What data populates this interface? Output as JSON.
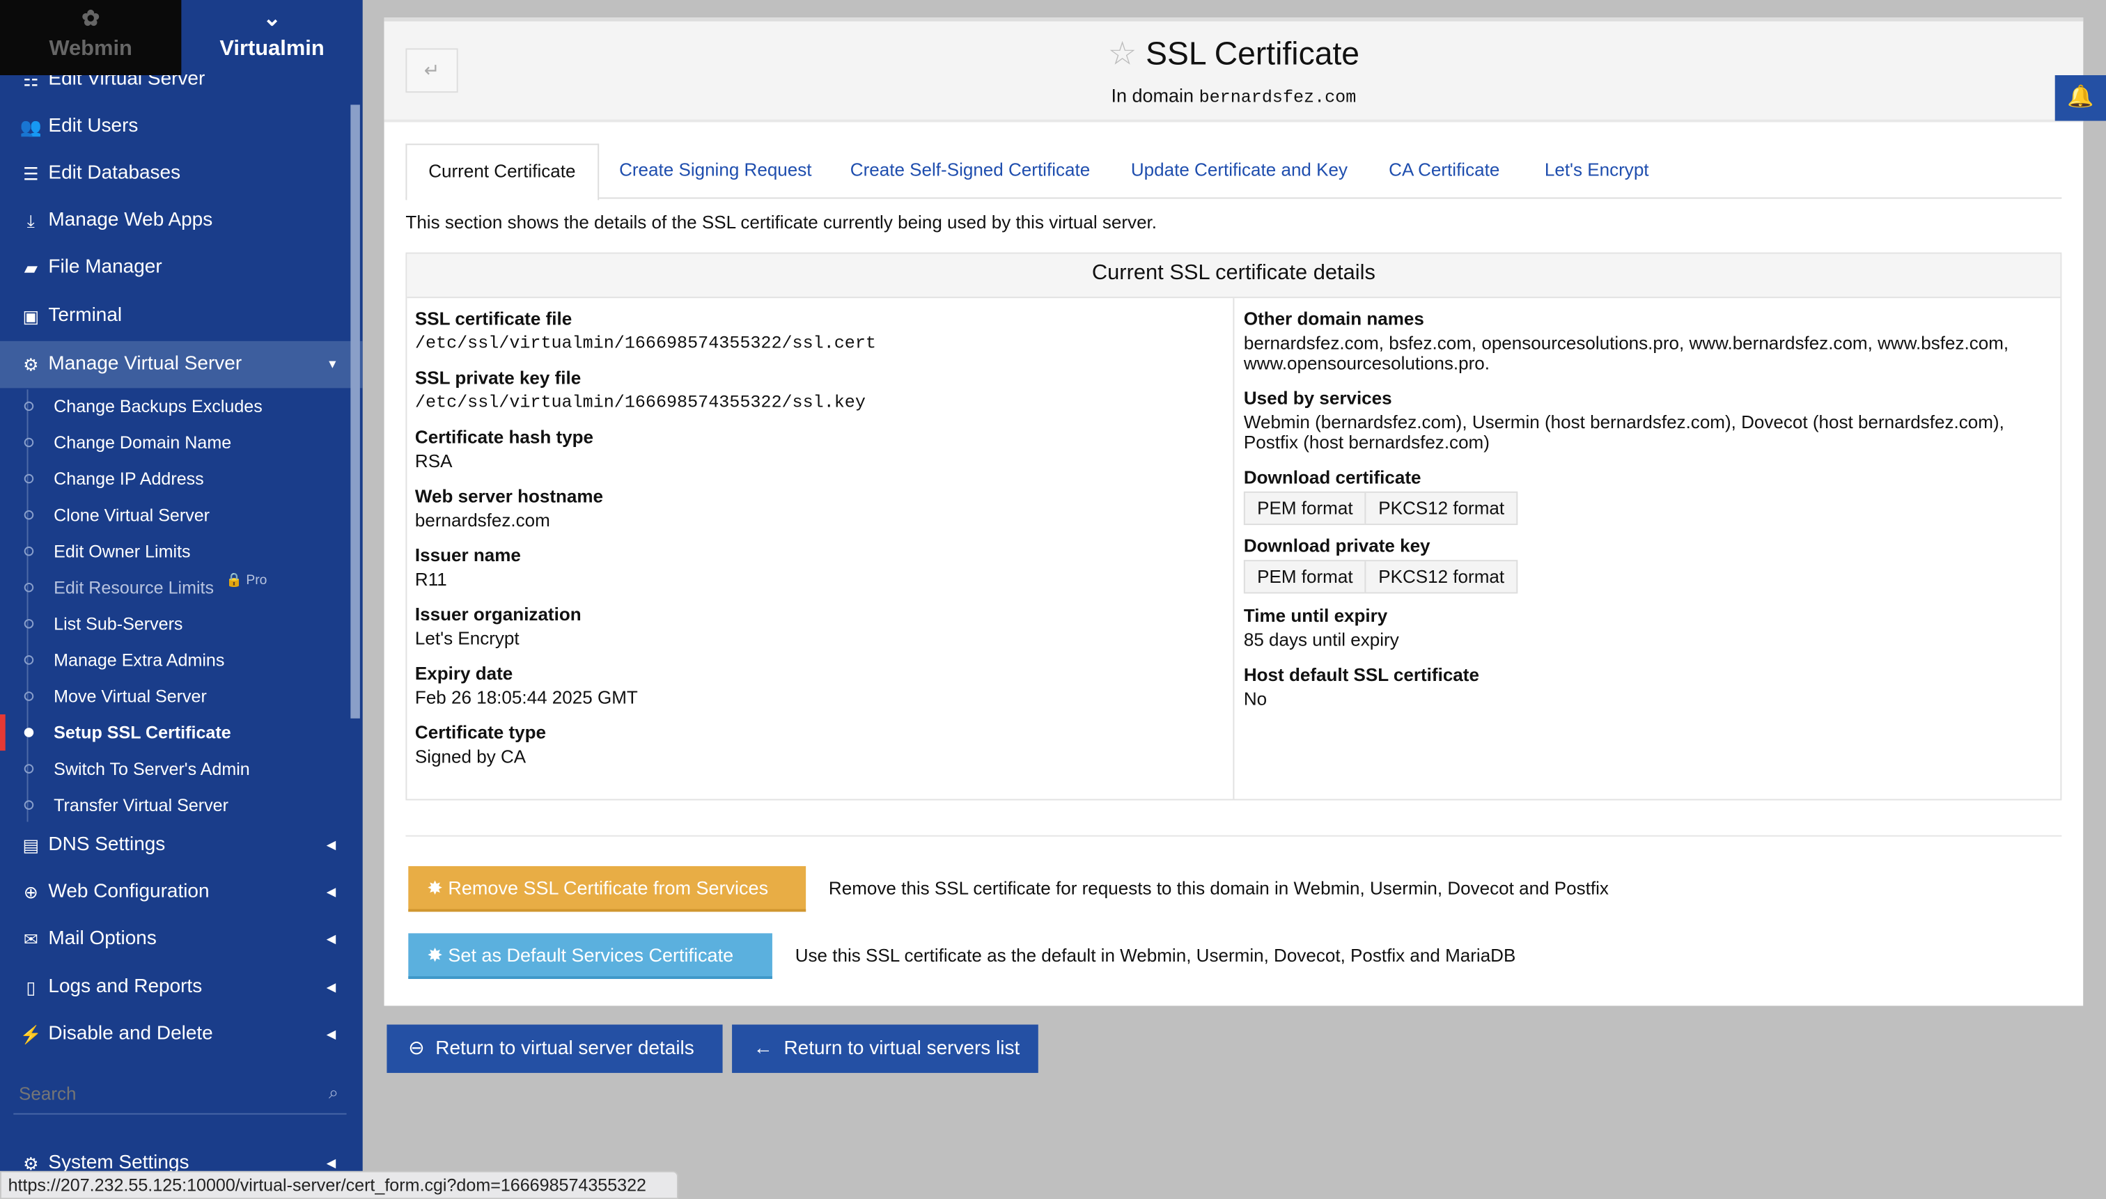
{
  "sidebar": {
    "tabs": [
      {
        "label": "Webmin",
        "icon": "webmin-logo-icon"
      },
      {
        "label": "Virtualmin",
        "icon": "virtualmin-chevron-icon"
      }
    ],
    "items": [
      {
        "label": "Edit Virtual Server",
        "icon": "sliders-icon"
      },
      {
        "label": "Edit Users",
        "icon": "users-cog-icon"
      },
      {
        "label": "Edit Databases",
        "icon": "database-icon"
      },
      {
        "label": "Manage Web Apps",
        "icon": "download-box-icon"
      },
      {
        "label": "File Manager",
        "icon": "folder-icon"
      },
      {
        "label": "Terminal",
        "icon": "terminal-icon"
      },
      {
        "label": "Manage Virtual Server",
        "icon": "cogs-icon"
      }
    ],
    "subitems": [
      "Change Backups Excludes",
      "Change Domain Name",
      "Change IP Address",
      "Clone Virtual Server",
      "Edit Owner Limits",
      "Edit Resource Limits",
      "List Sub-Servers",
      "Manage Extra Admins",
      "Move Virtual Server",
      "Setup SSL Certificate",
      "Switch To Server's Admin",
      "Transfer Virtual Server"
    ],
    "pro_badge": "Pro",
    "active_subitem": "Setup SSL Certificate",
    "groups": [
      {
        "label": "DNS Settings",
        "icon": "server-icon"
      },
      {
        "label": "Web Configuration",
        "icon": "globe-icon"
      },
      {
        "label": "Mail Options",
        "icon": "envelope-open-icon"
      },
      {
        "label": "Logs and Reports",
        "icon": "file-icon"
      },
      {
        "label": "Disable and Delete",
        "icon": "plug-icon"
      }
    ],
    "search_placeholder": "Search",
    "system_settings": "System Settings"
  },
  "header": {
    "title": "SSL Certificate",
    "subtitle_prefix": "In domain",
    "domain": "bernardsfez.com"
  },
  "tabs": [
    "Current Certificate",
    "Create Signing Request",
    "Create Self-Signed Certificate",
    "Update Certificate and Key",
    "CA Certificate",
    "Let's Encrypt"
  ],
  "description": "This section shows the details of the SSL certificate currently being used by this virtual server.",
  "table": {
    "title": "Current SSL certificate details",
    "left": [
      {
        "label": "SSL certificate file",
        "value": "/etc/ssl/virtualmin/166698574355322/ssl.cert"
      },
      {
        "label": "SSL private key file",
        "value": "/etc/ssl/virtualmin/166698574355322/ssl.key"
      },
      {
        "label": "Certificate hash type",
        "value": "RSA"
      },
      {
        "label": "Web server hostname",
        "value": "bernardsfez.com"
      },
      {
        "label": "Issuer name",
        "value": "R11"
      },
      {
        "label": "Issuer organization",
        "value": "Let's Encrypt"
      },
      {
        "label": "Expiry date",
        "value": "Feb 26 18:05:44 2025 GMT"
      },
      {
        "label": "Certificate type",
        "value": "Signed by CA"
      }
    ],
    "right": {
      "other_domains_label": "Other domain names",
      "other_domains": "bernardsfez.com, bsfez.com, opensourcesolutions.pro, www.bernardsfez.com, www.bsfez.com, www.opensourcesolutions.pro.",
      "used_by_label": "Used by services",
      "used_by": "Webmin (bernardsfez.com), Usermin (host bernardsfez.com), Dovecot (host bernardsfez.com), Postfix (host bernardsfez.com)",
      "download_cert_label": "Download certificate",
      "download_key_label": "Download private key",
      "pem": "PEM format",
      "pkcs12": "PKCS12 format",
      "expiry_label": "Time until expiry",
      "expiry": "85 days until expiry",
      "host_default_label": "Host default SSL certificate",
      "host_default": "No"
    }
  },
  "actions": [
    {
      "label": "Remove SSL Certificate from Services",
      "desc": "Remove this SSL certificate for requests to this domain in Webmin, Usermin, Dovecot and Postfix",
      "color": "#e8ad45"
    },
    {
      "label": "Set as Default Services Certificate",
      "desc": "Use this SSL certificate as the default in Webmin, Usermin, Dovecot, Postfix and MariaDB",
      "color": "#5bb0de"
    }
  ],
  "nav": {
    "back_details": "Return to virtual server details",
    "back_list": "Return to virtual servers list"
  },
  "status_url": "https://207.232.55.125:10000/virtual-server/cert_form.cgi?dom=166698574355322",
  "colors": {
    "sidebar": "#1a3d8a",
    "primary": "#2450a4",
    "link": "#1f4eae"
  }
}
